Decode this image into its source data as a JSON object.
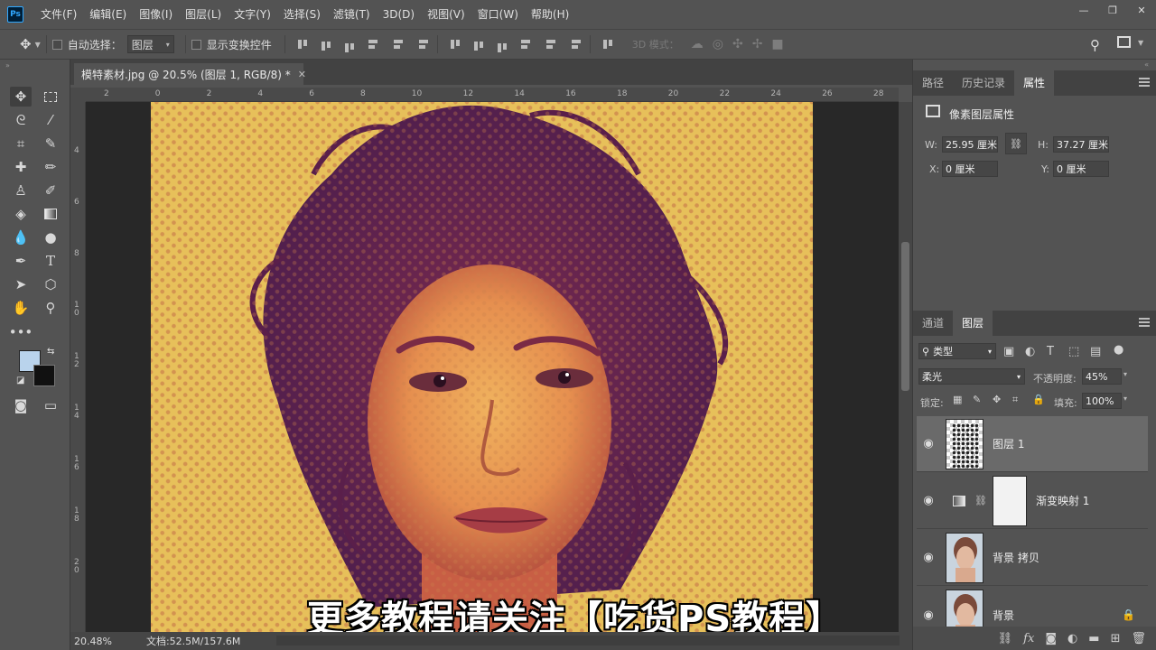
{
  "app": {
    "logo": "Ps"
  },
  "menu": [
    "文件(F)",
    "编辑(E)",
    "图像(I)",
    "图层(L)",
    "文字(Y)",
    "选择(S)",
    "滤镜(T)",
    "3D(D)",
    "视图(V)",
    "窗口(W)",
    "帮助(H)"
  ],
  "window_controls": {
    "minimize": "—",
    "restore": "❐",
    "close": "✕"
  },
  "options": {
    "auto_select_label": "自动选择：",
    "auto_select_value": "图层",
    "show_transform_label": "显示变换控件",
    "mode_3d_label": "3D 模式："
  },
  "document": {
    "tab_title": "模特素材.jpg @ 20.5% (图层 1, RGB/8) *",
    "ruler_h": [
      "2",
      "0",
      "2",
      "4",
      "6",
      "8",
      "10",
      "12",
      "14",
      "16",
      "18",
      "20",
      "22",
      "24",
      "26",
      "28"
    ],
    "ruler_v": [
      "4",
      "6",
      "8",
      "1 0",
      "1 2",
      "1 4",
      "1 6",
      "1 8",
      "2 0"
    ],
    "zoom": "20.48%",
    "doc_info": "文档:52.5M/157.6M",
    "subtitle": "更多教程请关注【吃货PS教程】"
  },
  "properties_panel": {
    "tabs": [
      "路径",
      "历史记录",
      "属性"
    ],
    "active_tab": "属性",
    "title": "像素图层属性",
    "w_label": "W:",
    "w_value": "25.95 厘米",
    "h_label": "H:",
    "h_value": "37.27 厘米",
    "x_label": "X:",
    "x_value": "0 厘米",
    "y_label": "Y:",
    "y_value": "0 厘米"
  },
  "layers_panel": {
    "tabs": [
      "通道",
      "图层"
    ],
    "active_tab": "图层",
    "filter_label": "类型",
    "blend_mode": "柔光",
    "opacity_label": "不透明度:",
    "opacity_value": "45%",
    "lock_label": "锁定:",
    "fill_label": "填充:",
    "fill_value": "100%",
    "layers": [
      {
        "name": "图层 1",
        "selected": true
      },
      {
        "name": "渐变映射 1",
        "selected": false
      },
      {
        "name": "背景 拷贝",
        "selected": false
      },
      {
        "name": "背景",
        "selected": false,
        "locked": true
      }
    ]
  },
  "colors": {
    "foreground": "#b9d3ec",
    "background": "#111111",
    "accent": "#31a8ff"
  }
}
